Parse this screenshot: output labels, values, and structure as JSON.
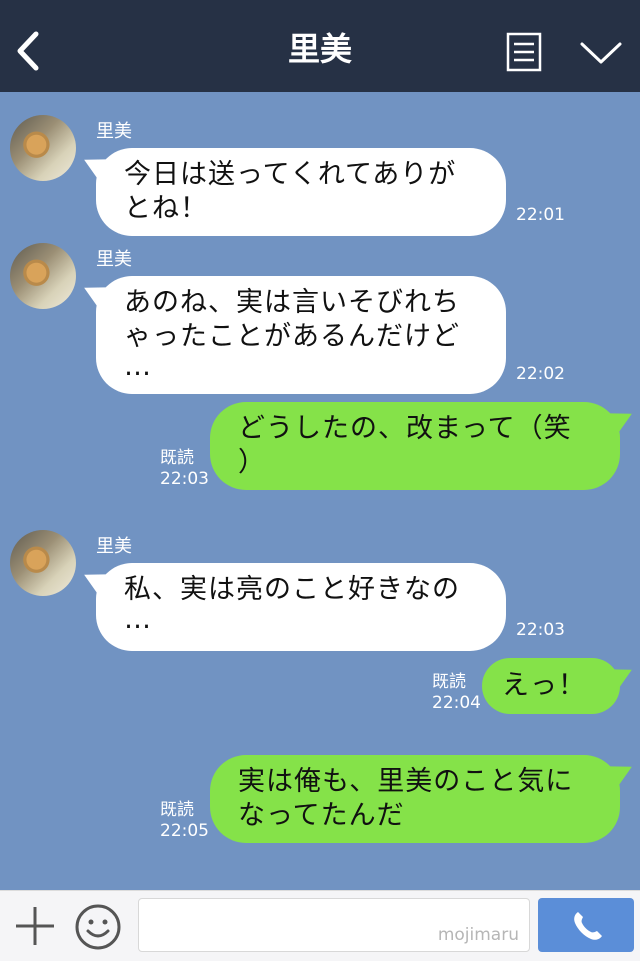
{
  "header": {
    "title": "里美"
  },
  "messages": [
    {
      "sender": "里美",
      "line1": "今日は送ってくれてありが",
      "line2": "とね！",
      "time": "22:01"
    },
    {
      "sender": "里美",
      "line1": "あのね、実は言いそびれち",
      "line2": "ゃったことがあるんだけど",
      "line3": "…",
      "time": "22:02"
    },
    {
      "read": "既読",
      "line1": "どうしたの、改まって（笑",
      "line2": "）",
      "time": "22:03"
    },
    {
      "sender": "里美",
      "line1": "私、実は亮のこと好きなの",
      "line2": "…",
      "time": "22:03"
    },
    {
      "read": "既読",
      "line1": "えっ！",
      "time": "22:04"
    },
    {
      "read": "既読",
      "line1": "実は俺も、里美のこと気に",
      "line2": "なってたんだ",
      "time": "22:05"
    }
  ],
  "footer": {
    "watermark": "mojimaru"
  },
  "colors": {
    "header_bg": "#263145",
    "chat_bg": "#7193c2",
    "outgoing_bubble": "#85e249",
    "incoming_bubble": "#ffffff",
    "call_button": "#5b8ed8"
  },
  "icons": [
    "back-icon",
    "menu-icon",
    "chevron-down-icon",
    "plus-icon",
    "emoji-icon",
    "phone-icon"
  ]
}
